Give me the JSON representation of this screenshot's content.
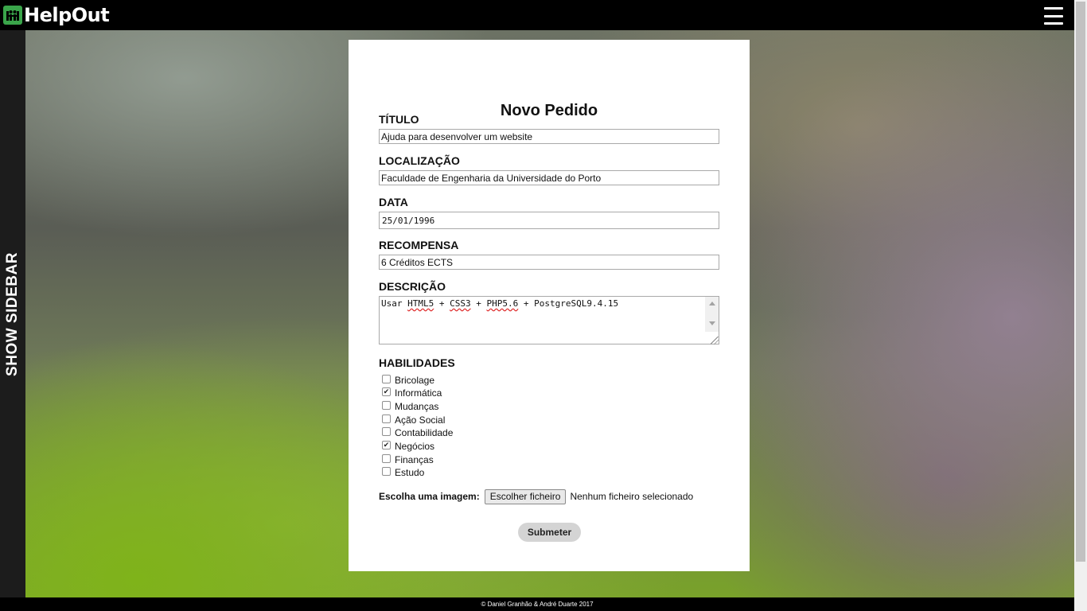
{
  "header": {
    "logo_text": "HelpOut"
  },
  "sidebar": {
    "toggle_label": "SHOW SIDEBAR"
  },
  "form": {
    "title": "Novo Pedido",
    "titulo": {
      "label": "TÍTULO",
      "value": "Ajuda para desenvolver um website"
    },
    "localizacao": {
      "label": "LOCALIZAÇÃO",
      "value": "Faculdade de Engenharia da Universidade do Porto"
    },
    "data": {
      "label": "DATA",
      "value": "25/01/1996"
    },
    "recompensa": {
      "label": "RECOMPENSA",
      "value": "6 Créditos ECTS"
    },
    "descricao": {
      "label": "DESCRIÇÃO",
      "parts": [
        "Usar ",
        "HTML5",
        " + ",
        "CSS3",
        " + ",
        "PHP5.6",
        " + PostgreSQL9.4.15"
      ]
    },
    "habilidades": {
      "label": "HABILIDADES",
      "items": [
        {
          "label": "Bricolage",
          "checked": false
        },
        {
          "label": "Informática",
          "checked": true
        },
        {
          "label": "Mudanças",
          "checked": false
        },
        {
          "label": "Ação Social",
          "checked": false
        },
        {
          "label": "Contabilidade",
          "checked": false
        },
        {
          "label": "Negócios",
          "checked": true
        },
        {
          "label": "Finanças",
          "checked": false
        },
        {
          "label": "Estudo",
          "checked": false
        }
      ]
    },
    "imagem": {
      "label": "Escolha uma imagem:",
      "button_label": "Escolher ficheiro",
      "status": "Nenhum ficheiro selecionado"
    },
    "submit_label": "Submeter"
  },
  "footer": {
    "text": "© Daniel Granhão & André Duarte 2017"
  }
}
